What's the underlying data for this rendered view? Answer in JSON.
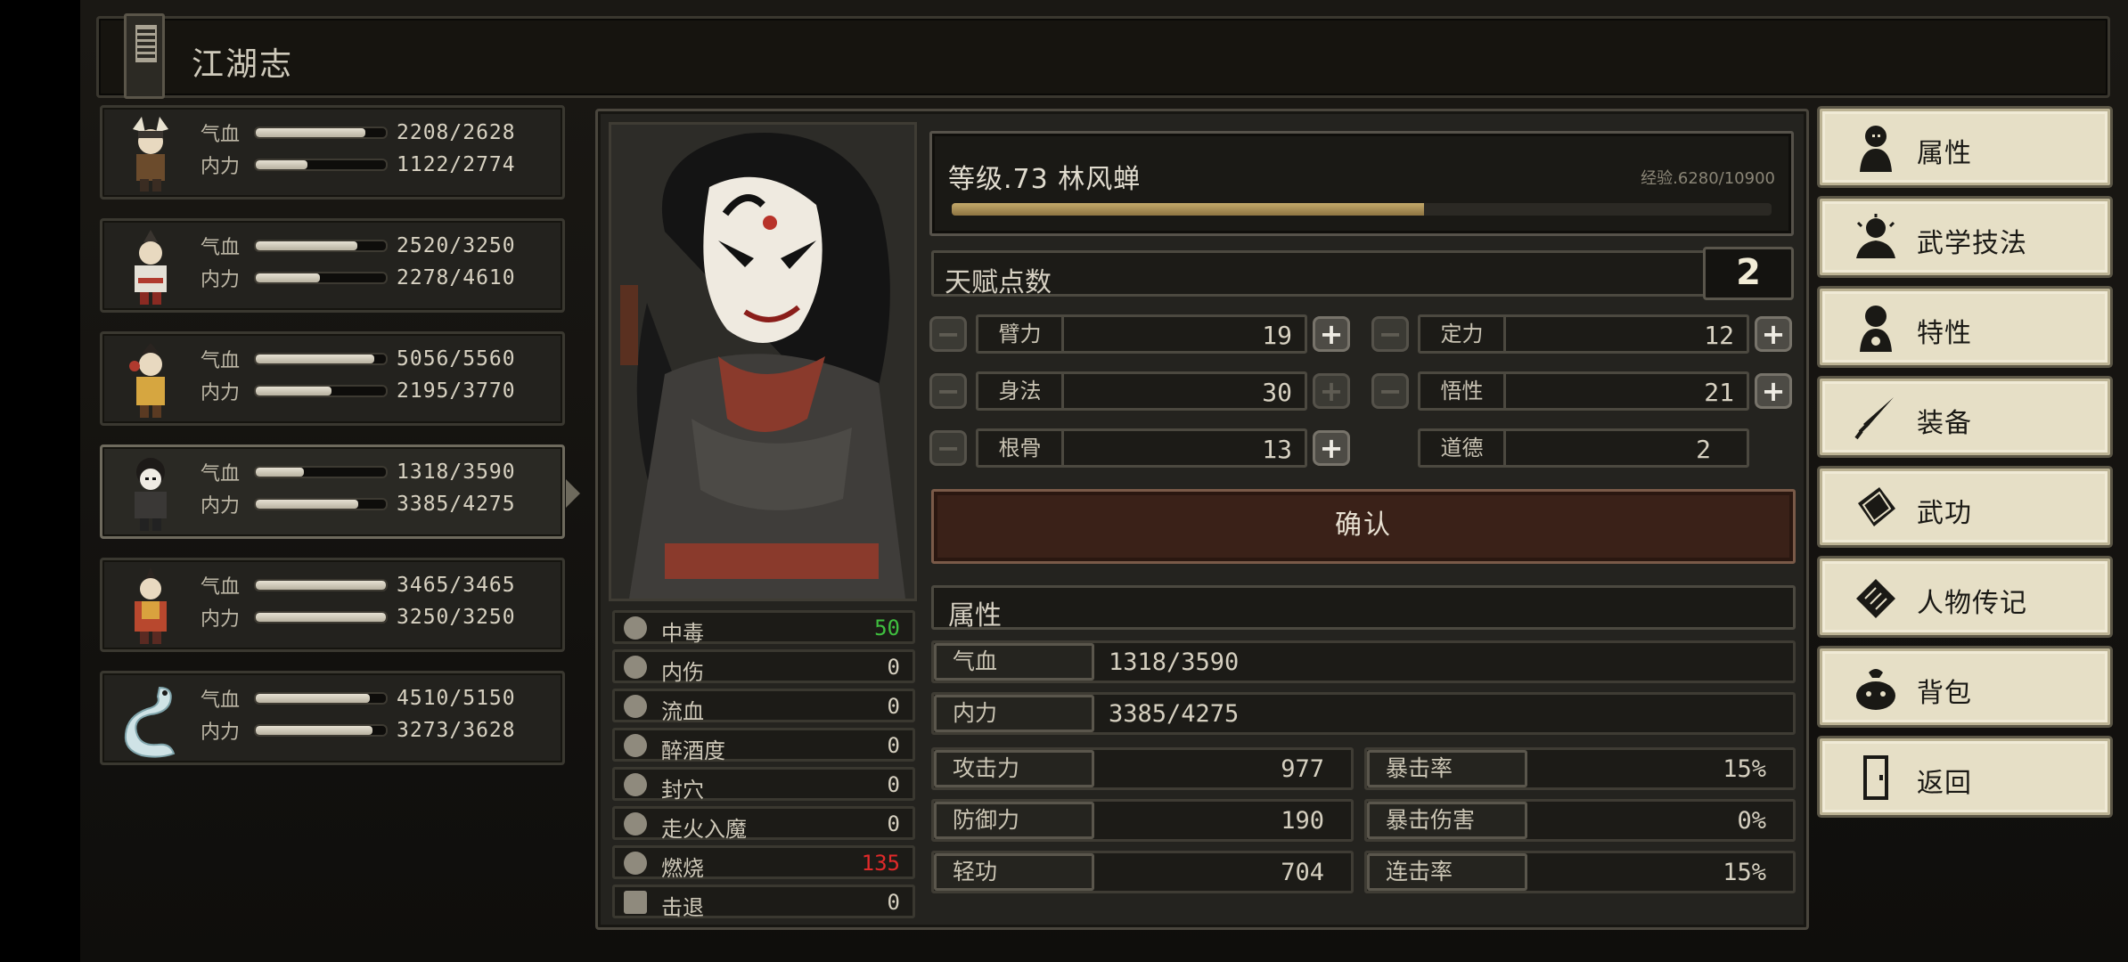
{
  "header": {
    "title": "江湖志"
  },
  "party": [
    {
      "hp_label": "气血",
      "hp": "2208/2628",
      "hp_frac": 0.84,
      "mp_label": "内力",
      "mp": "1122/2774",
      "mp_frac": 0.4,
      "avatar": "warrior-horned-helmet"
    },
    {
      "hp_label": "气血",
      "hp": "2520/3250",
      "hp_frac": 0.78,
      "mp_label": "内力",
      "mp": "2278/4610",
      "mp_frac": 0.49,
      "avatar": "warrior-white-robe"
    },
    {
      "hp_label": "气血",
      "hp": "5056/5560",
      "hp_frac": 0.91,
      "mp_label": "内力",
      "mp": "2195/3770",
      "mp_frac": 0.58,
      "avatar": "warrior-yellow"
    },
    {
      "hp_label": "气血",
      "hp": "1318/3590",
      "hp_frac": 0.37,
      "mp_label": "内力",
      "mp": "3385/4275",
      "mp_frac": 0.79,
      "avatar": "warrior-masked",
      "active": true
    },
    {
      "hp_label": "气血",
      "hp": "3465/3465",
      "hp_frac": 1.0,
      "mp_label": "内力",
      "mp": "3250/3250",
      "mp_frac": 1.0,
      "avatar": "warrior-red"
    },
    {
      "hp_label": "气血",
      "hp": "4510/5150",
      "hp_frac": 0.88,
      "mp_label": "内力",
      "mp": "3273/3628",
      "mp_frac": 0.9,
      "avatar": "white-snake"
    }
  ],
  "character": {
    "level_text": "等级.73  林风蝉",
    "exp_text": "经验.6280/10900",
    "exp_frac": 0.576
  },
  "talent": {
    "label": "天赋点数",
    "points": "2"
  },
  "attributes": [
    {
      "name": "臂力",
      "value": "19"
    },
    {
      "name": "定力",
      "value": "12"
    },
    {
      "name": "身法",
      "value": "30"
    },
    {
      "name": "悟性",
      "value": "21"
    },
    {
      "name": "根骨",
      "value": "13"
    },
    {
      "name": "道德",
      "value": "2"
    }
  ],
  "confirm_label": "确认",
  "stats_title": "属性",
  "stats": {
    "hp_label": "气血",
    "hp": "1318/3590",
    "mp_label": "内力",
    "mp": "3385/4275",
    "atk_label": "攻击力",
    "atk": "977",
    "crit_label": "暴击率",
    "crit": "15%",
    "def_label": "防御力",
    "def": "190",
    "critdmg_label": "暴击伤害",
    "critdmg": "0%",
    "qg_label": "轻功",
    "qg": "704",
    "combo_label": "连击率",
    "combo": "15%"
  },
  "status_effects": [
    {
      "name": "中毒",
      "value": "50",
      "color": "#3fbf3f",
      "icon": "skull-icon"
    },
    {
      "name": "内伤",
      "value": "0",
      "color": "#d6d0c0",
      "icon": "broken-heart-icon"
    },
    {
      "name": "流血",
      "value": "0",
      "color": "#d6d0c0",
      "icon": "blood-splash-icon"
    },
    {
      "name": "醉酒度",
      "value": "0",
      "color": "#d6d0c0",
      "icon": "drunk-face-icon"
    },
    {
      "name": "封穴",
      "value": "0",
      "color": "#d6d0c0",
      "icon": "acupoint-icon"
    },
    {
      "name": "走火入魔",
      "value": "0",
      "color": "#d6d0c0",
      "icon": "demon-face-icon"
    },
    {
      "name": "燃烧",
      "value": "135",
      "color": "#e02a2a",
      "icon": "fire-icon"
    },
    {
      "name": "击退",
      "value": "0",
      "color": "#d6d0c0",
      "icon": "boot-icon"
    }
  ],
  "menu": [
    {
      "label": "属性",
      "icon": "person-icon"
    },
    {
      "label": "武学技法",
      "icon": "meditate-icon"
    },
    {
      "label": "特性",
      "icon": "trait-person-icon"
    },
    {
      "label": "装备",
      "icon": "sword-icon"
    },
    {
      "label": "武功",
      "icon": "book-icon"
    },
    {
      "label": "人物传记",
      "icon": "scroll-icon"
    },
    {
      "label": "背包",
      "icon": "bag-icon"
    },
    {
      "label": "返回",
      "icon": "door-icon"
    }
  ]
}
